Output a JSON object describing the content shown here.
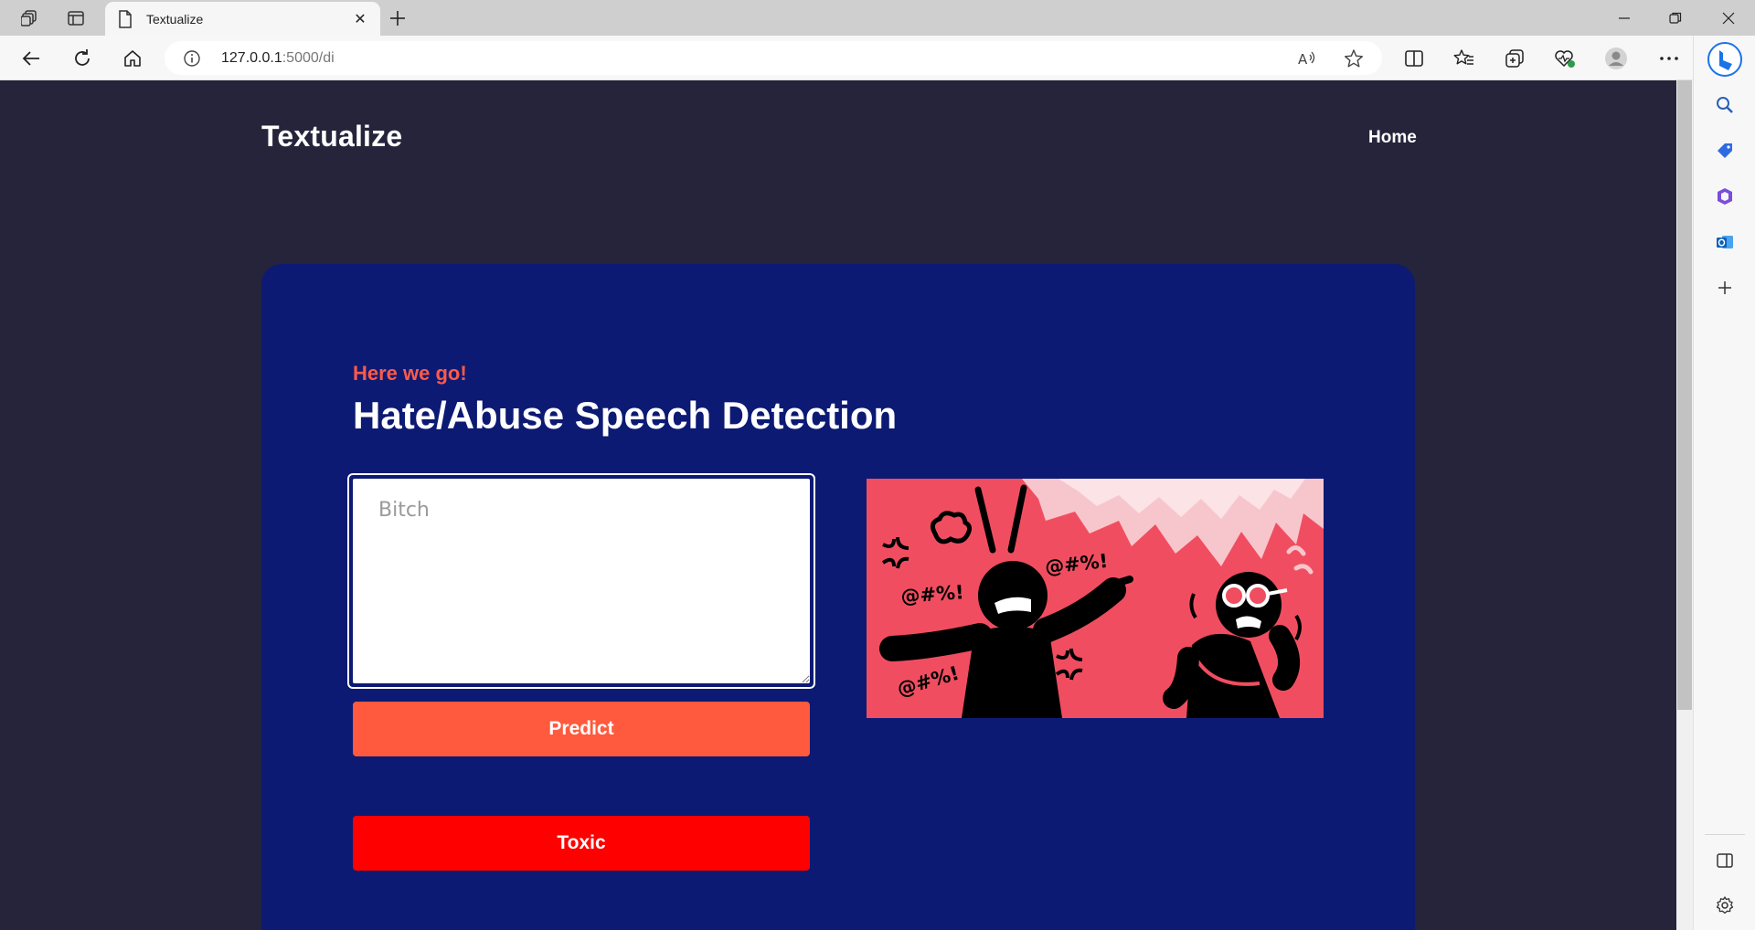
{
  "browser": {
    "tab_title": "Textualize",
    "url_host": "127.0.0.1",
    "url_path": ":5000/di"
  },
  "page": {
    "brand": "Textualize",
    "nav": {
      "home": "Home"
    },
    "eyebrow": "Here we go!",
    "heading": "Hate/Abuse Speech Detection",
    "input_value": "Bitch",
    "predict_label": "Predict",
    "result_label": "Toxic",
    "illustration_texts": [
      "@#%!",
      "@#%!",
      "@#%!"
    ]
  },
  "colors": {
    "page_bg": "#25243a",
    "card_bg": "#0c1a74",
    "accent": "#ff5a48",
    "predict_button": "#ff5a3e",
    "result_toxic": "#ff0000",
    "illustration_bg": "#f04e60"
  }
}
